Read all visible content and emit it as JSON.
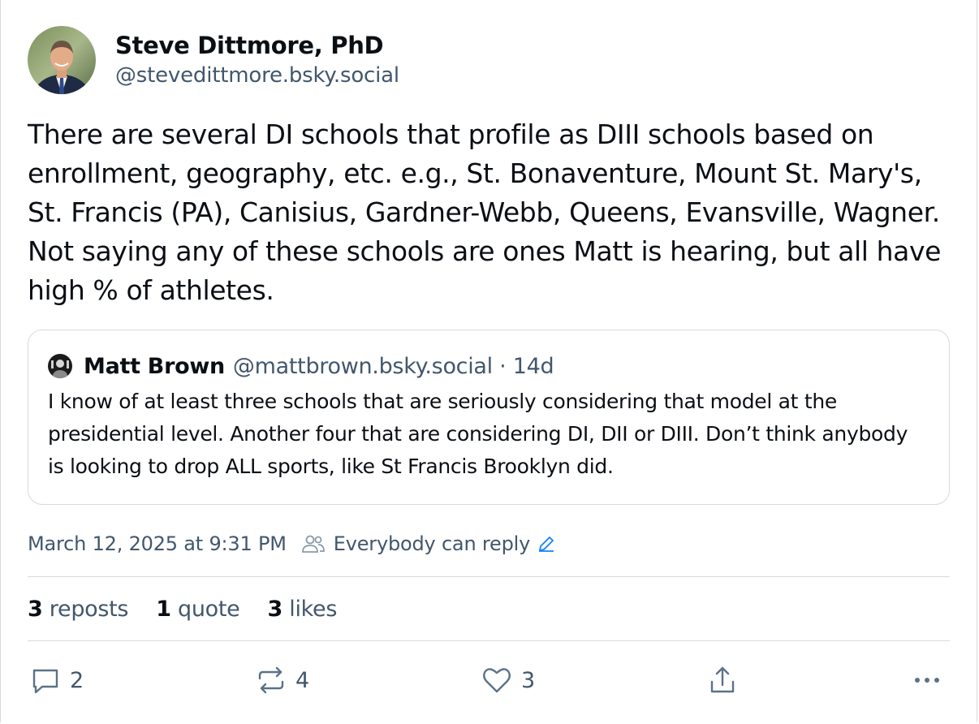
{
  "post": {
    "author": {
      "name": "Steve Dittmore, PhD",
      "handle": "@stevedittmore.bsky.social"
    },
    "text": "There are several DI schools that profile as DIII schools based on enrollment, geography, etc. e.g., St. Bonaventure, Mount St. Mary's, St. Francis (PA), Canisius, Gardner-Webb, Queens, Evansville, Wagner. Not saying any of these schools are ones Matt is hearing, but all have high % of athletes.",
    "quote": {
      "name": "Matt Brown",
      "meta": "@mattbrown.bsky.social · 14d",
      "text": "I know of at least three schools that are seriously considering that model at the presidential level. Another four that are considering DI, DII or DIII. Don’t think anybody is looking to drop ALL sports, like St Francis Brooklyn did."
    },
    "timestamp": "March 12, 2025 at 9:31 PM",
    "reply_setting": "Everybody can reply",
    "stats": {
      "reposts_count": "3",
      "reposts_label": "reposts",
      "quotes_count": "1",
      "quotes_label": "quote",
      "likes_count": "3",
      "likes_label": "likes"
    },
    "actions": {
      "reply_count": "2",
      "repost_count": "4",
      "like_count": "3"
    }
  },
  "colors": {
    "text": "#0b0f14",
    "muted": "#42576c",
    "border": "#d4dbe2",
    "accent": "#1083fe"
  },
  "icons": [
    "reply-icon",
    "repost-icon",
    "like-icon",
    "share-icon",
    "more-icon",
    "people-icon",
    "pencil-icon"
  ]
}
